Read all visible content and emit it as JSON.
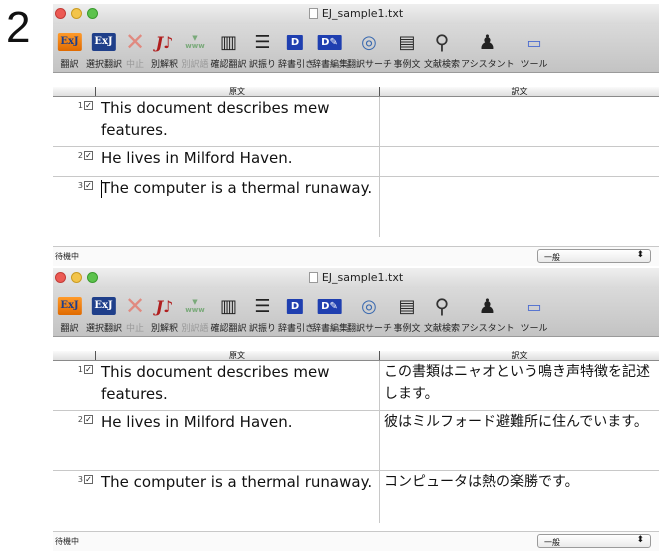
{
  "step_number": "2",
  "window": {
    "title": "EJ_sample1.txt"
  },
  "toolbar": {
    "buttons": [
      {
        "label": "翻訳",
        "icon": "exj-translate-icon",
        "icon_text": "ExJ",
        "enabled": true
      },
      {
        "label": "選択翻訳",
        "icon": "exj-selection-translate-icon",
        "icon_text": "ExJ",
        "enabled": true
      },
      {
        "label": "中止",
        "icon": "stop-icon",
        "icon_text": "✕",
        "enabled": false
      },
      {
        "label": "別解釈",
        "icon": "alternative-interpretation-icon",
        "icon_text": "J",
        "enabled": true
      },
      {
        "label": "別訳語",
        "icon": "alternative-word-icon",
        "icon_text": "www",
        "enabled": false
      },
      {
        "label": "確認翻訳",
        "icon": "confirm-translate-icon",
        "icon_text": "▥",
        "enabled": true
      },
      {
        "label": "訳振り",
        "icon": "furigana-translation-icon",
        "icon_text": "☰",
        "enabled": true
      },
      {
        "label": "辞書引き",
        "icon": "dictionary-lookup-icon",
        "icon_text": "D",
        "enabled": true
      },
      {
        "label": "辞書編集",
        "icon": "dictionary-edit-icon",
        "icon_text": "D",
        "enabled": true
      },
      {
        "label": "翻訳サーチ",
        "icon": "translation-search-icon",
        "icon_text": "◎",
        "enabled": true
      },
      {
        "label": "事例文",
        "icon": "example-sentence-icon",
        "icon_text": "▤",
        "enabled": true
      },
      {
        "label": "文献検索",
        "icon": "document-search-icon",
        "icon_text": "⚲",
        "enabled": true
      },
      {
        "label": "アシスタント",
        "icon": "assistant-icon",
        "icon_text": "♟",
        "enabled": true
      },
      {
        "label": "ツール",
        "icon": "tool-icon",
        "icon_text": "▭",
        "enabled": true
      }
    ]
  },
  "columns": {
    "source": "原文",
    "translation": "訳文"
  },
  "window_before": {
    "rows": [
      {
        "num": "1",
        "checked": true,
        "source": "This document describes mew features.",
        "translation": ""
      },
      {
        "num": "2",
        "checked": true,
        "source": "He lives in Milford Haven.",
        "translation": ""
      },
      {
        "num": "3",
        "checked": true,
        "source": "The computer is a thermal runaway.",
        "translation": ""
      }
    ]
  },
  "window_after": {
    "rows": [
      {
        "num": "1",
        "checked": true,
        "source": "This document describes mew features.",
        "translation": "この書類はニャオという鳴き声特徴を記述します。"
      },
      {
        "num": "2",
        "checked": true,
        "source": "He lives in Milford Haven.",
        "translation": "彼はミルフォード避難所に住んでいます。"
      },
      {
        "num": "3",
        "checked": true,
        "source": "The computer is a thermal runaway.",
        "translation": "コンピュータは熱の楽勝です。"
      }
    ]
  },
  "statusbar": {
    "status": "待機中",
    "field_value": "一般"
  },
  "colors": {
    "close": "#ec5a54",
    "minimize": "#f3c44a",
    "zoom": "#5cc24c"
  }
}
